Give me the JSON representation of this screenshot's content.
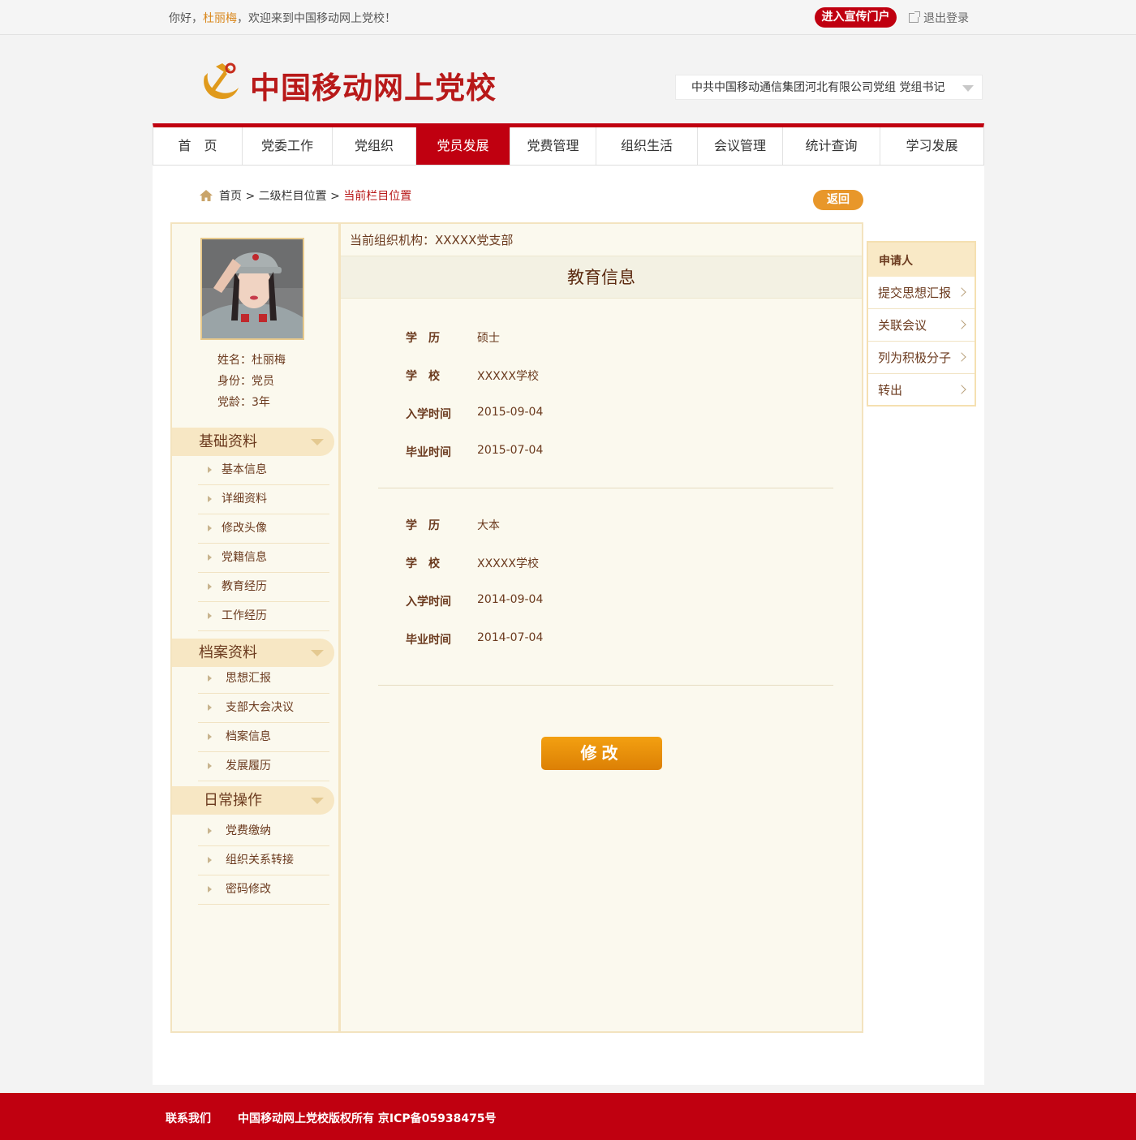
{
  "topbar": {
    "greeting_prefix": "你好，",
    "user_name": "杜丽梅",
    "greeting_suffix": "，欢迎来到中国移动网上党校！",
    "portal_label": "进入宣传门户",
    "logout_label": "退出登录"
  },
  "header": {
    "site_title": "中国移动网上党校",
    "org_role": "中共中国移动通信集团河北有限公司党组 党组书记",
    "logo_icon": "hammer-sickle-icon"
  },
  "nav": {
    "items": [
      "首　页",
      "党委工作",
      "党组织",
      "党员发展",
      "党费管理",
      "组织生活",
      "会议管理",
      "统计查询",
      "学习发展"
    ],
    "active": "党员发展"
  },
  "breadcrumb": {
    "home": "首页",
    "sep": ">",
    "level2": "二级栏目位置",
    "current": "当前栏目位置"
  },
  "back_label": "返回",
  "profile": {
    "name_line": "姓名：杜丽梅",
    "status_line": "身份：党员",
    "age_line": "党龄：3年"
  },
  "sidebar": {
    "sections": [
      {
        "title": "基础资料",
        "items": [
          "基本信息",
          "详细资料",
          "修改头像",
          "党籍信息",
          "教育经历",
          "工作经历"
        ]
      },
      {
        "title": "档案资料",
        "items": [
          "思想汇报",
          "支部大会决议",
          "档案信息",
          "发展履历"
        ]
      },
      {
        "title": "日常操作",
        "items": [
          "党费缴纳",
          "组织关系转接",
          "密码修改"
        ]
      }
    ]
  },
  "content": {
    "org_line": "当前组织机构：XXXXX党支部",
    "heading": "教育信息",
    "records": [
      {
        "labels": [
          "学　历",
          "学　校",
          "入学时间",
          "毕业时间"
        ],
        "values": [
          "硕士",
          "XXXXX学校",
          "2015-09-04",
          "2015-07-04"
        ]
      },
      {
        "labels": [
          "学　历",
          "学　校",
          "入学时间",
          "毕业时间"
        ],
        "values": [
          "大本",
          "XXXXX学校",
          "2014-09-04",
          "2014-07-04"
        ]
      }
    ],
    "edit_label": "修改"
  },
  "right_menu": {
    "title": "申请人",
    "items": [
      "提交思想汇报",
      "关联会议",
      "列为积极分子",
      "转出"
    ]
  },
  "footer": {
    "contact": "联系我们",
    "copyright": "中国移动网上党校版权所有 京ICP备05938475号"
  },
  "colors": {
    "brand_red": "#c00010",
    "accent_orange": "#e8972a",
    "panel_bg": "#fbf9ee",
    "text_brown": "#6b3a1e"
  }
}
